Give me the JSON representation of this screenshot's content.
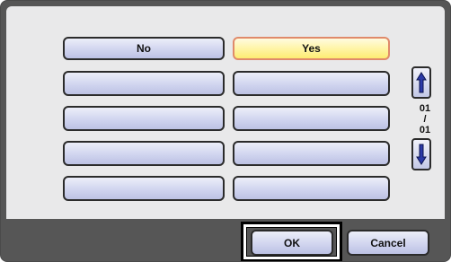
{
  "options": [
    {
      "label": "No",
      "selected": false
    },
    {
      "label": "Yes",
      "selected": true
    },
    {
      "label": "",
      "selected": false
    },
    {
      "label": "",
      "selected": false
    },
    {
      "label": "",
      "selected": false
    },
    {
      "label": "",
      "selected": false
    },
    {
      "label": "",
      "selected": false
    },
    {
      "label": "",
      "selected": false
    },
    {
      "label": "",
      "selected": false
    },
    {
      "label": "",
      "selected": false
    }
  ],
  "pager": {
    "current": "01",
    "separator": "/",
    "total": "01",
    "up_icon": "arrow-up-icon",
    "down_icon": "arrow-down-icon"
  },
  "footer": {
    "ok_label": "OK",
    "cancel_label": "Cancel"
  },
  "colors": {
    "selected_fill": "#fff4a2",
    "selected_border": "#e08a6a",
    "option_fill": "#d1d5ef",
    "panel": "#e9e9ea",
    "footer": "#565656"
  }
}
